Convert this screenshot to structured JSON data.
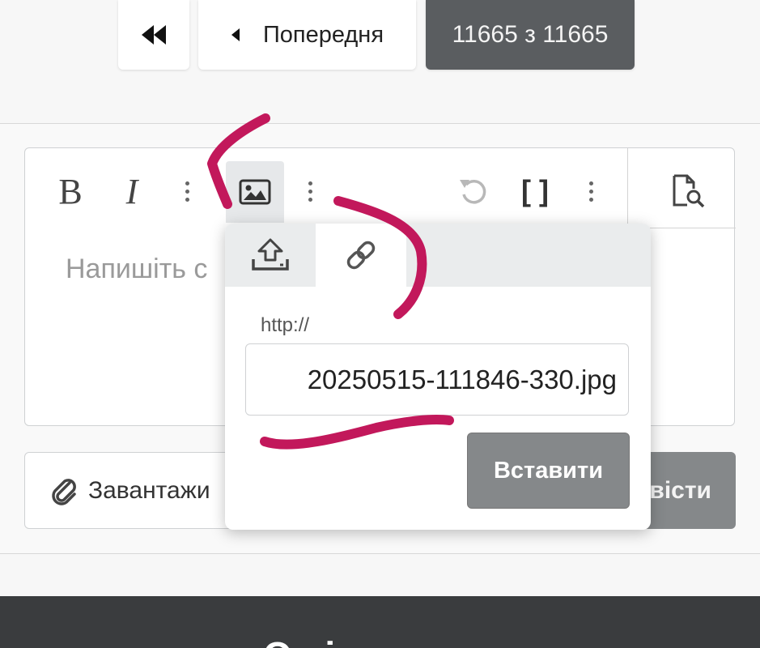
{
  "pagination": {
    "first_icon": "double-chevron-left-icon",
    "prev_icon": "caret-left-icon",
    "prev_label": "Попередня",
    "counter": "11665 з 11665"
  },
  "editor": {
    "toolbar": {
      "bold_label": "B",
      "italic_label": "I",
      "brackets_label": "[ ]",
      "icons": [
        "more-vertical-icon",
        "image-icon",
        "undo-icon",
        "brackets-icon",
        "preview-document-icon"
      ]
    },
    "placeholder": "Напишіть с"
  },
  "image_popup": {
    "tabs": [
      "upload-icon",
      "link-icon"
    ],
    "url_label": "http://",
    "url_value": "20250515-111846-330.jpg",
    "insert_label": "Вставити"
  },
  "attachments": {
    "upload_label": "Завантажи",
    "icon": "paperclip-icon"
  },
  "submit": {
    "label": "вісти"
  },
  "footer": {
    "text": "Оп  і"
  },
  "colors": {
    "annotation": "#c2185b",
    "dark_button": "#5a5d60",
    "grey_button": "#85888a"
  }
}
